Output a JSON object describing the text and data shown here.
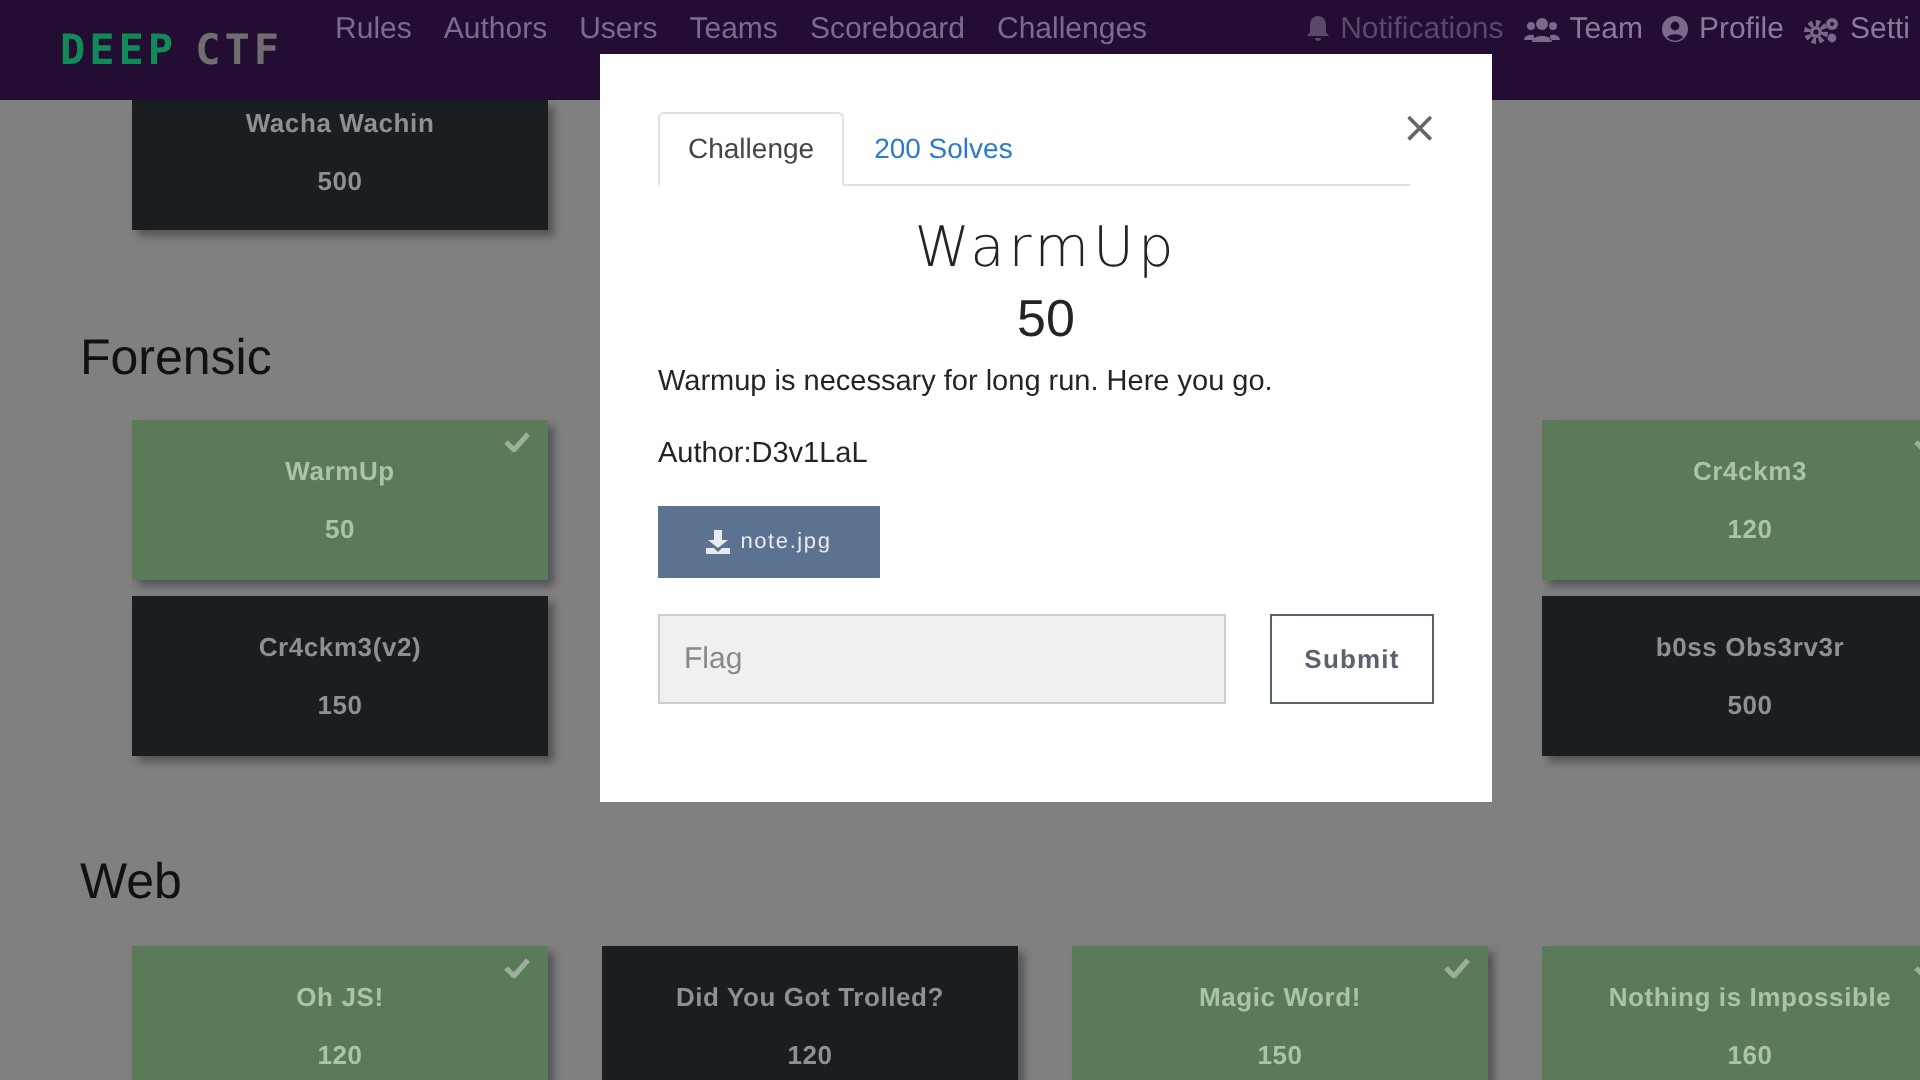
{
  "navbar": {
    "logo": {
      "first": "DEEP",
      "second": "CTF"
    },
    "links": [
      {
        "label": "Rules"
      },
      {
        "label": "Authors"
      },
      {
        "label": "Users"
      },
      {
        "label": "Teams"
      },
      {
        "label": "Scoreboard"
      },
      {
        "label": "Challenges"
      }
    ],
    "right_links": [
      {
        "kind": "bell",
        "label": "Notifications"
      },
      {
        "kind": "team",
        "label": "Team"
      },
      {
        "kind": "profile",
        "label": "Profile"
      },
      {
        "kind": "settings",
        "label": "Setti"
      }
    ]
  },
  "sections": [
    {
      "rows": [
        [
          {
            "name": "Wacha Wachin",
            "value": "500",
            "solved": false
          },
          null,
          null,
          null
        ]
      ]
    },
    {
      "title": "Forensic",
      "rows": [
        [
          {
            "name": "WarmUp",
            "value": "50",
            "solved": true
          },
          null,
          null,
          {
            "name": "Cr4ckm3",
            "value": "120",
            "solved": true
          }
        ],
        [
          {
            "name": "Cr4ckm3(v2)",
            "value": "150",
            "solved": false
          },
          null,
          null,
          {
            "name": "b0ss Obs3rv3r",
            "value": "500",
            "solved": false
          }
        ]
      ]
    },
    {
      "title": "Web",
      "rows": [
        [
          {
            "name": "Oh JS!",
            "value": "120",
            "solved": true
          },
          {
            "name": "Did You Got Trolled?",
            "value": "120",
            "solved": false
          },
          {
            "name": "Magic Word!",
            "value": "150",
            "solved": true
          },
          {
            "name": "Nothing is Impossible",
            "value": "160",
            "solved": true
          }
        ]
      ]
    }
  ],
  "modal": {
    "tabs": [
      {
        "label": "Challenge",
        "selected": true
      },
      {
        "label": "200 Solves",
        "selected": false
      }
    ],
    "close": "×",
    "title": "WarmUp",
    "value": "50",
    "description": "Warmup is necessary for long run. Here you go.",
    "author": "Author:D3v1LaL",
    "file": "note.jpg",
    "flag": {
      "placeholder": "Flag"
    },
    "submit": "Submit"
  }
}
